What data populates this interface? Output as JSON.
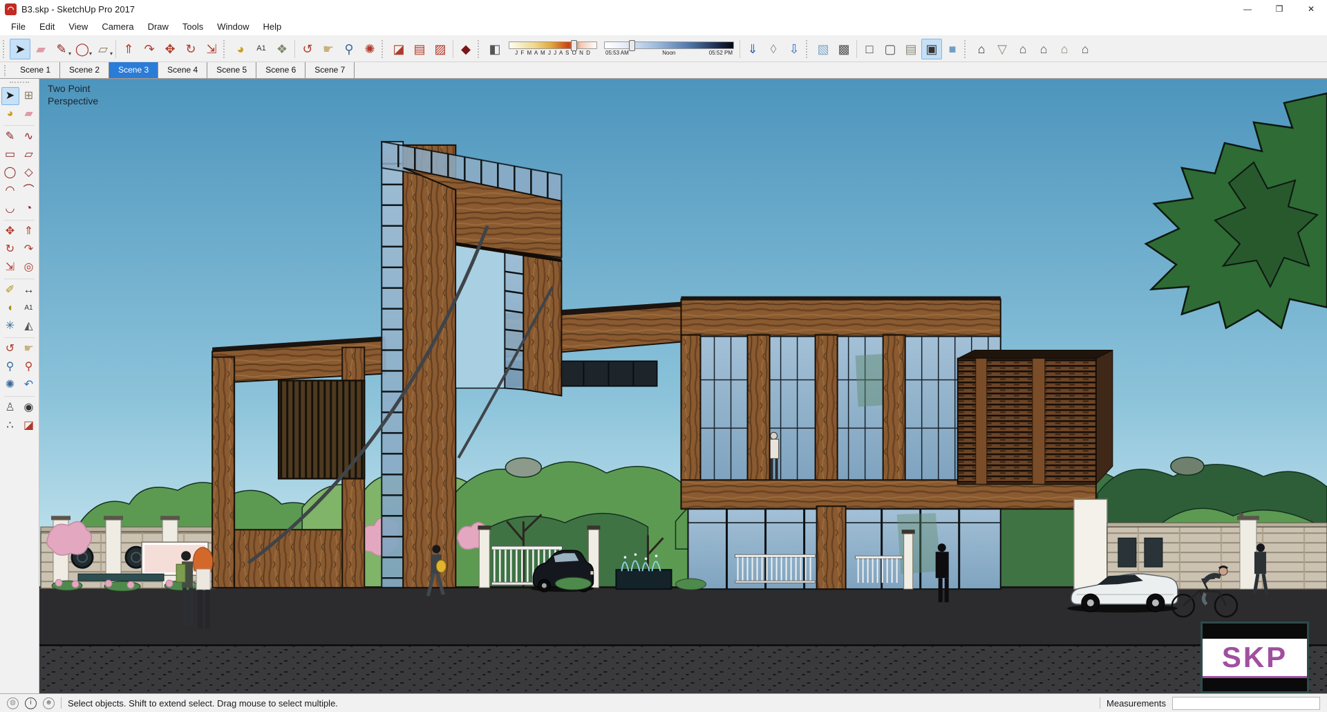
{
  "colors": {
    "sky_top": "#4d95bd",
    "sky_mid": "#8cc3da",
    "sky_bottom": "#cfeaf2",
    "road": "#2c2c2e",
    "road_front": "#3a3a3c",
    "wood_base": "#8a5a30",
    "wood_dark": "#5e3c1e",
    "wood_light": "#a5713e",
    "glass": "#a3c0d6",
    "glass_dark": "#7fa3bf",
    "tree_light": "#7fb469",
    "tree_mid": "#5c9a52",
    "tree_dark": "#3f7344",
    "tree_xdark": "#2e5e38",
    "big_tree": "#2f6b35",
    "blossom": "#e3a8bf",
    "stone": "#cbc2b2",
    "accent_blue": "#2a7cd6",
    "selection_bg": "#c5e0f7",
    "watermark_purple": "#a04fa0"
  },
  "window": {
    "title": "B3.skp - SketchUp Pro 2017",
    "controls": [
      {
        "name": "minimize-button",
        "glyph": "—"
      },
      {
        "name": "restore-button",
        "glyph": "❒"
      },
      {
        "name": "close-button",
        "glyph": "✕"
      }
    ]
  },
  "menubar": {
    "items": [
      "File",
      "Edit",
      "View",
      "Camera",
      "Draw",
      "Tools",
      "Window",
      "Help"
    ]
  },
  "toolbar": {
    "groups": [
      {
        "items": [
          {
            "name": "select-tool",
            "glyph": "➤",
            "color": "#1a1a1a",
            "active": true
          },
          {
            "name": "eraser-tool",
            "glyph": "▰",
            "color": "#e09aa6"
          },
          {
            "name": "line-tool",
            "glyph": "✎",
            "color": "#8a2020",
            "dropdown": true
          },
          {
            "name": "shapes-tool",
            "glyph": "◯",
            "color": "#a32c22",
            "dropdown": true
          },
          {
            "name": "rectangle-tool",
            "glyph": "▱",
            "color": "#8a7a66",
            "dropdown": true
          }
        ]
      },
      {
        "items": [
          {
            "name": "push-pull-tool",
            "glyph": "⇑",
            "color": "#b03a2a"
          },
          {
            "name": "follow-me-tool",
            "glyph": "↷",
            "color": "#b03a2a"
          },
          {
            "name": "move-tool",
            "glyph": "✥",
            "color": "#b03a2a"
          },
          {
            "name": "rotate-tool",
            "glyph": "↻",
            "color": "#b03a2a"
          },
          {
            "name": "scale-tool",
            "glyph": "⇲",
            "color": "#b03a2a"
          }
        ]
      },
      {
        "items": [
          {
            "name": "paint-bucket-tool",
            "glyph": "◕",
            "color": "#c8a020"
          },
          {
            "name": "text-tool",
            "glyph": "A1",
            "color": "#333333"
          },
          {
            "name": "materials-tool",
            "glyph": "❖",
            "color": "#7d8a6a"
          }
        ]
      },
      {
        "items": [
          {
            "name": "orbit-tool",
            "glyph": "↺",
            "color": "#b03a2a"
          },
          {
            "name": "pan-tool",
            "glyph": "☛",
            "color": "#c8b080"
          },
          {
            "name": "zoom-tool",
            "glyph": "⚲",
            "color": "#3a6a9a"
          },
          {
            "name": "zoom-extents-tool",
            "glyph": "✺",
            "color": "#b03a2a"
          }
        ]
      },
      {
        "items": [
          {
            "name": "section-plane-tool",
            "glyph": "◪",
            "color": "#b03a2a"
          },
          {
            "name": "section-display-tool",
            "glyph": "▤",
            "color": "#b03a2a"
          },
          {
            "name": "section-cuts-tool",
            "glyph": "▨",
            "color": "#b03a2a"
          }
        ]
      },
      {
        "items": [
          {
            "name": "plugin-gem-tool",
            "glyph": "◆",
            "color": "#7a1616"
          }
        ]
      },
      {
        "shadow": true,
        "items": [
          {
            "name": "shadow-toggle",
            "glyph": "◧",
            "color": "#555555"
          }
        ],
        "date_slider": {
          "name": "shadow-date-slider",
          "months": "J F M A M J J A S O N D",
          "handle_pct": 71
        },
        "time_slider": {
          "name": "shadow-time-slider",
          "start": "05:53 AM",
          "mid": "Noon",
          "end": "05:52 PM",
          "handle_pct": 19
        }
      },
      {
        "items": [
          {
            "name": "get-models-tool",
            "glyph": "⇓",
            "color": "#2a6fbf"
          },
          {
            "name": "share-model-tool",
            "glyph": "◊",
            "color": "#9a9a92"
          },
          {
            "name": "share-component-tool",
            "glyph": "⇩",
            "color": "#2a6fbf"
          }
        ]
      },
      {
        "items": [
          {
            "name": "xray-style",
            "glyph": "▧",
            "color": "#7fa8c8"
          },
          {
            "name": "back-edges-style",
            "glyph": "▩",
            "color": "#555555"
          }
        ]
      },
      {
        "items": [
          {
            "name": "wireframe-style",
            "glyph": "□",
            "color": "#333333"
          },
          {
            "name": "hidden-line-style",
            "glyph": "▢",
            "color": "#555555"
          },
          {
            "name": "shaded-style",
            "glyph": "▤",
            "color": "#8a8a7a"
          },
          {
            "name": "shaded-textures-style",
            "glyph": "▣",
            "color": "#333333",
            "active": true
          },
          {
            "name": "monochrome-style",
            "glyph": "■",
            "color": "#6f9fc8"
          }
        ]
      },
      {
        "items": [
          {
            "name": "iso-view",
            "glyph": "⌂",
            "color": "#333333"
          },
          {
            "name": "top-view",
            "glyph": "▽",
            "color": "#8a8a7a"
          },
          {
            "name": "front-view",
            "glyph": "⌂",
            "color": "#555555"
          },
          {
            "name": "right-view",
            "glyph": "⌂",
            "color": "#555555"
          },
          {
            "name": "back-view",
            "glyph": "⌂",
            "color": "#8a8a7a"
          },
          {
            "name": "left-view",
            "glyph": "⌂",
            "color": "#555555"
          }
        ]
      }
    ]
  },
  "scene_tabs": {
    "items": [
      "Scene 1",
      "Scene 2",
      "Scene 3",
      "Scene 4",
      "Scene 5",
      "Scene 6",
      "Scene 7"
    ],
    "active_index": 2
  },
  "palette": {
    "rows": [
      {
        "tools": [
          {
            "name": "select-tool",
            "glyph": "➤",
            "color": "#1a1a1a",
            "active": true
          },
          {
            "name": "make-component-tool",
            "glyph": "⊞",
            "color": "#8a7a66"
          }
        ]
      },
      {
        "tools": [
          {
            "name": "paint-bucket-tool",
            "glyph": "◕",
            "color": "#c8a020"
          },
          {
            "name": "eraser-tool",
            "glyph": "▰",
            "color": "#e09aa6"
          }
        ]
      },
      {
        "sep": true
      },
      {
        "tools": [
          {
            "name": "line-tool",
            "glyph": "✎",
            "color": "#8a2020"
          },
          {
            "name": "freehand-tool",
            "glyph": "∿",
            "color": "#8a2020"
          }
        ]
      },
      {
        "tools": [
          {
            "name": "rectangle-tool",
            "glyph": "▭",
            "color": "#8a2020"
          },
          {
            "name": "rotated-rectangle-tool",
            "glyph": "▱",
            "color": "#8a2020"
          }
        ]
      },
      {
        "tools": [
          {
            "name": "circle-tool",
            "glyph": "◯",
            "color": "#8a2020"
          },
          {
            "name": "polygon-tool",
            "glyph": "◇",
            "color": "#8a2020"
          }
        ]
      },
      {
        "tools": [
          {
            "name": "arc-tool",
            "glyph": "◠",
            "color": "#8a2020"
          },
          {
            "name": "two-point-arc-tool",
            "glyph": "⌒",
            "color": "#8a2020"
          }
        ]
      },
      {
        "tools": [
          {
            "name": "three-point-arc-tool",
            "glyph": "◡",
            "color": "#8a2020"
          },
          {
            "name": "pie-tool",
            "glyph": "◔",
            "color": "#8a2020"
          }
        ]
      },
      {
        "sep": true
      },
      {
        "tools": [
          {
            "name": "move-tool",
            "glyph": "✥",
            "color": "#b03a2a"
          },
          {
            "name": "push-pull-tool",
            "glyph": "⇑",
            "color": "#b03a2a"
          }
        ]
      },
      {
        "tools": [
          {
            "name": "rotate-tool",
            "glyph": "↻",
            "color": "#b03a2a"
          },
          {
            "name": "follow-me-tool",
            "glyph": "↷",
            "color": "#b03a2a"
          }
        ]
      },
      {
        "tools": [
          {
            "name": "scale-tool",
            "glyph": "⇲",
            "color": "#b03a2a"
          },
          {
            "name": "offset-tool",
            "glyph": "◎",
            "color": "#b03a2a"
          }
        ]
      },
      {
        "sep": true
      },
      {
        "tools": [
          {
            "name": "tape-measure-tool",
            "glyph": "✐",
            "color": "#a8901a"
          },
          {
            "name": "dimension-tool",
            "glyph": "↔",
            "color": "#333333"
          }
        ]
      },
      {
        "tools": [
          {
            "name": "protractor-tool",
            "glyph": "◖",
            "color": "#a8901a"
          },
          {
            "name": "text-tool",
            "glyph": "A1",
            "color": "#333333"
          }
        ]
      },
      {
        "tools": [
          {
            "name": "axes-tool",
            "glyph": "✳",
            "color": "#3a6a9a"
          },
          {
            "name": "threed-text-tool",
            "glyph": "◭",
            "color": "#555555"
          }
        ]
      },
      {
        "sep": true
      },
      {
        "tools": [
          {
            "name": "orbit-tool",
            "glyph": "↺",
            "color": "#b03a2a"
          },
          {
            "name": "pan-tool",
            "glyph": "☛",
            "color": "#c8b080"
          }
        ]
      },
      {
        "tools": [
          {
            "name": "zoom-tool",
            "glyph": "⚲",
            "color": "#3a6a9a"
          },
          {
            "name": "zoom-window-tool",
            "glyph": "⚲",
            "color": "#b03a2a"
          }
        ]
      },
      {
        "tools": [
          {
            "name": "zoom-extents-tool",
            "glyph": "✺",
            "color": "#3a6a9a"
          },
          {
            "name": "previous-view-tool",
            "glyph": "↶",
            "color": "#2a6fbf"
          }
        ]
      },
      {
        "sep": true
      },
      {
        "tools": [
          {
            "name": "position-camera-tool",
            "glyph": "♙",
            "color": "#555555"
          },
          {
            "name": "look-around-tool",
            "glyph": "◉",
            "color": "#333333"
          }
        ]
      },
      {
        "tools": [
          {
            "name": "walk-tool",
            "glyph": "∴",
            "color": "#333333"
          },
          {
            "name": "section-plane-tool",
            "glyph": "◪",
            "color": "#b03a2a"
          }
        ]
      }
    ]
  },
  "viewport": {
    "camera_label_line1": "Two Point",
    "camera_label_line2": "Perspective"
  },
  "watermark": {
    "text": "SKP"
  },
  "statusbar": {
    "icons": [
      {
        "name": "geolocation-icon",
        "glyph": "◍",
        "dark": false
      },
      {
        "name": "credits-icon",
        "glyph": "i",
        "dark": true
      },
      {
        "name": "sign-in-icon",
        "glyph": "☻",
        "dark": false
      }
    ],
    "message": "Select objects. Shift to extend select. Drag mouse to select multiple.",
    "measurements_label": "Measurements",
    "measurements_value": ""
  }
}
